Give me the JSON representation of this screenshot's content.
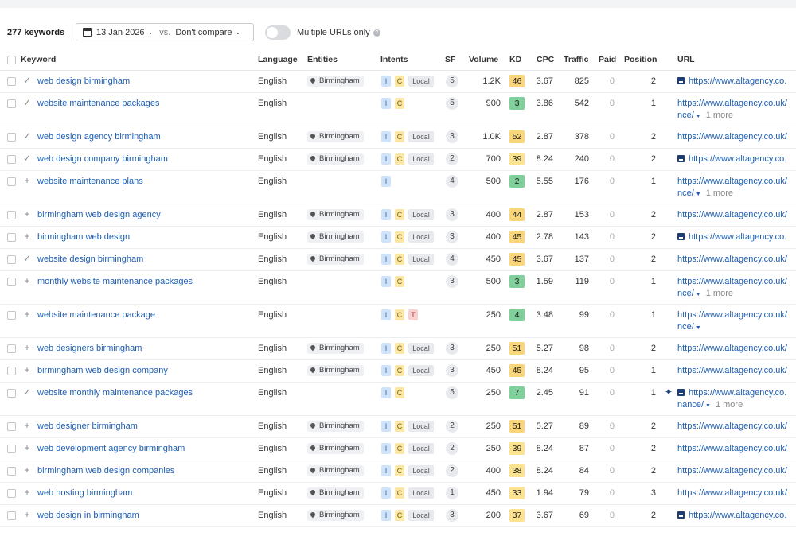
{
  "toolbar": {
    "keyword_count": "277 keywords",
    "date": "13 Jan 2026",
    "vs": "vs.",
    "compare": "Don't compare",
    "multiple_urls_label": "Multiple URLs only"
  },
  "columns": [
    "Keyword",
    "Language",
    "Entities",
    "Intents",
    "SF",
    "Volume",
    "KD",
    "CPC",
    "Traffic",
    "Paid",
    "Position",
    "URL"
  ],
  "colors": {
    "kd_high": "#fad67a",
    "kd_mid": "#fbe38f",
    "kd_low": "#7fd09a",
    "link": "#1d5eb3"
  },
  "rows": [
    {
      "keyword": "web design birmingham",
      "mark": "✓",
      "language": "English",
      "entity": "Birmingham",
      "intents": [
        "I",
        "C",
        "Local"
      ],
      "sf": "5",
      "volume": "1.2K",
      "kd": "46",
      "cpc": "3.67",
      "traffic": "825",
      "paid": "0",
      "position": "2",
      "url": "https://www.altagency.co.",
      "url2": "",
      "more": "",
      "img": true,
      "spark": false,
      "h": 28
    },
    {
      "keyword": "website maintenance packages",
      "mark": "✓",
      "language": "English",
      "entity": "",
      "intents": [
        "I",
        "C"
      ],
      "sf": "5",
      "volume": "900",
      "kd": "3",
      "cpc": "3.86",
      "traffic": "542",
      "paid": "0",
      "position": "1",
      "url": "https://www.altagency.co.uk/",
      "url2": "nce/",
      "more": "1 more",
      "img": false,
      "spark": false,
      "h": 42
    },
    {
      "keyword": "web design agency birmingham",
      "mark": "✓",
      "language": "English",
      "entity": "Birmingham",
      "intents": [
        "I",
        "C",
        "Local"
      ],
      "sf": "3",
      "volume": "1.0K",
      "kd": "52",
      "cpc": "2.87",
      "traffic": "378",
      "paid": "0",
      "position": "2",
      "url": "https://www.altagency.co.uk/",
      "url2": "",
      "more": "",
      "img": false,
      "spark": false,
      "h": 28
    },
    {
      "keyword": "web design company birmingham",
      "mark": "✓",
      "language": "English",
      "entity": "Birmingham",
      "intents": [
        "I",
        "C",
        "Local"
      ],
      "sf": "2",
      "volume": "700",
      "kd": "39",
      "cpc": "8.24",
      "traffic": "240",
      "paid": "0",
      "position": "2",
      "url": "https://www.altagency.co.",
      "url2": "",
      "more": "",
      "img": true,
      "spark": false,
      "h": 28
    },
    {
      "keyword": "website maintenance plans",
      "mark": "+",
      "language": "English",
      "entity": "",
      "intents": [
        "I"
      ],
      "sf": "4",
      "volume": "500",
      "kd": "2",
      "cpc": "5.55",
      "traffic": "176",
      "paid": "0",
      "position": "1",
      "url": "https://www.altagency.co.uk/",
      "url2": "nce/",
      "more": "1 more",
      "img": false,
      "spark": false,
      "h": 42
    },
    {
      "keyword": "birmingham web design agency",
      "mark": "+",
      "language": "English",
      "entity": "Birmingham",
      "intents": [
        "I",
        "C",
        "Local"
      ],
      "sf": "3",
      "volume": "400",
      "kd": "44",
      "cpc": "2.87",
      "traffic": "153",
      "paid": "0",
      "position": "2",
      "url": "https://www.altagency.co.uk/",
      "url2": "",
      "more": "",
      "img": false,
      "spark": false,
      "h": 28
    },
    {
      "keyword": "birmingham web design",
      "mark": "+",
      "language": "English",
      "entity": "Birmingham",
      "intents": [
        "I",
        "C",
        "Local"
      ],
      "sf": "3",
      "volume": "400",
      "kd": "45",
      "cpc": "2.78",
      "traffic": "143",
      "paid": "0",
      "position": "2",
      "url": "https://www.altagency.co.",
      "url2": "",
      "more": "",
      "img": true,
      "spark": false,
      "h": 28
    },
    {
      "keyword": "website design birmingham",
      "mark": "✓",
      "language": "English",
      "entity": "Birmingham",
      "intents": [
        "I",
        "C",
        "Local"
      ],
      "sf": "4",
      "volume": "450",
      "kd": "45",
      "cpc": "3.67",
      "traffic": "137",
      "paid": "0",
      "position": "2",
      "url": "https://www.altagency.co.uk/",
      "url2": "",
      "more": "",
      "img": false,
      "spark": false,
      "h": 28
    },
    {
      "keyword": "monthly website maintenance packages",
      "mark": "+",
      "language": "English",
      "entity": "",
      "intents": [
        "I",
        "C"
      ],
      "sf": "3",
      "volume": "500",
      "kd": "3",
      "cpc": "1.59",
      "traffic": "119",
      "paid": "0",
      "position": "1",
      "url": "https://www.altagency.co.uk/",
      "url2": "nce/",
      "more": "1 more",
      "img": false,
      "spark": false,
      "h": 42
    },
    {
      "keyword": "website maintenance package",
      "mark": "+",
      "language": "English",
      "entity": "",
      "intents": [
        "I",
        "C",
        "T"
      ],
      "sf": "",
      "volume": "250",
      "kd": "4",
      "cpc": "3.48",
      "traffic": "99",
      "paid": "0",
      "position": "1",
      "url": "https://www.altagency.co.uk/",
      "url2": "nce/",
      "more": "",
      "img": false,
      "spark": false,
      "h": 42
    },
    {
      "keyword": "web designers birmingham",
      "mark": "+",
      "language": "English",
      "entity": "Birmingham",
      "intents": [
        "I",
        "C",
        "Local"
      ],
      "sf": "3",
      "volume": "250",
      "kd": "51",
      "cpc": "5.27",
      "traffic": "98",
      "paid": "0",
      "position": "2",
      "url": "https://www.altagency.co.uk/",
      "url2": "",
      "more": "",
      "img": false,
      "spark": false,
      "h": 28
    },
    {
      "keyword": "birmingham web design company",
      "mark": "+",
      "language": "English",
      "entity": "Birmingham",
      "intents": [
        "I",
        "C",
        "Local"
      ],
      "sf": "3",
      "volume": "450",
      "kd": "45",
      "cpc": "8.24",
      "traffic": "95",
      "paid": "0",
      "position": "1",
      "url": "https://www.altagency.co.uk/",
      "url2": "",
      "more": "",
      "img": false,
      "spark": false,
      "h": 28
    },
    {
      "keyword": "website monthly maintenance packages",
      "mark": "✓",
      "language": "English",
      "entity": "",
      "intents": [
        "I",
        "C"
      ],
      "sf": "5",
      "volume": "250",
      "kd": "7",
      "cpc": "2.45",
      "traffic": "91",
      "paid": "0",
      "position": "1",
      "url": "https://www.altagency.co.",
      "url2": "nance/",
      "more": "1 more",
      "img": true,
      "spark": true,
      "h": 42
    },
    {
      "keyword": "web designer birmingham",
      "mark": "+",
      "language": "English",
      "entity": "Birmingham",
      "intents": [
        "I",
        "C",
        "Local"
      ],
      "sf": "2",
      "volume": "250",
      "kd": "51",
      "cpc": "5.27",
      "traffic": "89",
      "paid": "0",
      "position": "2",
      "url": "https://www.altagency.co.uk/",
      "url2": "",
      "more": "",
      "img": false,
      "spark": false,
      "h": 28
    },
    {
      "keyword": "web development agency birmingham",
      "mark": "+",
      "language": "English",
      "entity": "Birmingham",
      "intents": [
        "I",
        "C",
        "Local"
      ],
      "sf": "2",
      "volume": "250",
      "kd": "39",
      "cpc": "8.24",
      "traffic": "87",
      "paid": "0",
      "position": "2",
      "url": "https://www.altagency.co.uk/",
      "url2": "",
      "more": "",
      "img": false,
      "spark": false,
      "h": 28
    },
    {
      "keyword": "birmingham web design companies",
      "mark": "+",
      "language": "English",
      "entity": "Birmingham",
      "intents": [
        "I",
        "C",
        "Local"
      ],
      "sf": "2",
      "volume": "400",
      "kd": "38",
      "cpc": "8.24",
      "traffic": "84",
      "paid": "0",
      "position": "2",
      "url": "https://www.altagency.co.uk/",
      "url2": "",
      "more": "",
      "img": false,
      "spark": false,
      "h": 28
    },
    {
      "keyword": "web hosting birmingham",
      "mark": "+",
      "language": "English",
      "entity": "Birmingham",
      "intents": [
        "I",
        "C",
        "Local"
      ],
      "sf": "1",
      "volume": "450",
      "kd": "33",
      "cpc": "1.94",
      "traffic": "79",
      "paid": "0",
      "position": "3",
      "url": "https://www.altagency.co.uk/",
      "url2": "",
      "more": "",
      "img": false,
      "spark": false,
      "h": 28
    },
    {
      "keyword": "web design in birmingham",
      "mark": "+",
      "language": "English",
      "entity": "Birmingham",
      "intents": [
        "I",
        "C",
        "Local"
      ],
      "sf": "3",
      "volume": "200",
      "kd": "37",
      "cpc": "3.67",
      "traffic": "69",
      "paid": "0",
      "position": "2",
      "url": "https://www.altagency.co.",
      "url2": "",
      "more": "",
      "img": true,
      "spark": false,
      "h": 28
    }
  ]
}
